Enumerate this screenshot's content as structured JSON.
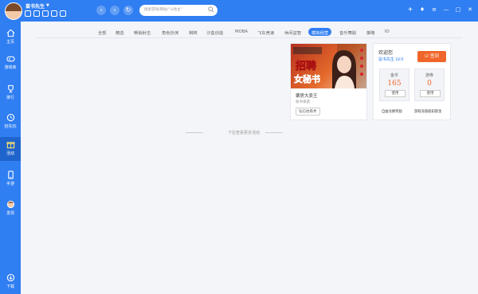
{
  "header": {
    "username": "鼠书先生",
    "search_placeholder": "搜索游戏/网站/\"斗地主\"",
    "window_controls": [
      "pin-icon",
      "skin-icon",
      "menu-icon",
      "minimize-icon",
      "maximize-icon",
      "close-icon"
    ]
  },
  "sidebar": {
    "items": [
      {
        "label": "主页",
        "icon": "home-icon"
      },
      {
        "label": "游戏库",
        "icon": "gamepad-icon"
      },
      {
        "label": "排行",
        "icon": "trophy-icon"
      },
      {
        "label": "抢先玩",
        "icon": "clock-icon"
      },
      {
        "label": "活动",
        "icon": "gift-icon"
      },
      {
        "label": "手游",
        "icon": "phone-icon"
      },
      {
        "label": "发现",
        "icon": "discover-icon"
      },
      {
        "label": "下载",
        "icon": "download-icon"
      }
    ],
    "active_index": 4
  },
  "categories": {
    "tabs": [
      "全部",
      "精选",
      "畅销射击",
      "角色扮演",
      "棋牌",
      "沙盒创造",
      "MOBA",
      "飞车竞速",
      "休闲益智",
      "模拟经营",
      "音乐舞蹈",
      "策略",
      "IO"
    ],
    "active_index": 9
  },
  "card": {
    "image_text": {
      "line1": "招聘",
      "line2": "女秘书"
    },
    "title": "票房大卖王",
    "subtitle": "秘书来袭",
    "badge": "钻石始看秀"
  },
  "panel": {
    "welcome": "欢迎您",
    "username": "鼠书先生 LV.0",
    "checkin_label": "签到",
    "gold": {
      "label": "金币",
      "value": "165",
      "button": "使用"
    },
    "voucher": {
      "label": "游券",
      "value": "0",
      "button": "使用"
    },
    "gold_note": "自由兑换奖励",
    "voucher_note": "游戏充值抵扣现金"
  },
  "more_hint": "下拉查看更多活动",
  "colors": {
    "primary": "#2f7ef2",
    "accent": "#f0662a",
    "background": "#f3f5f8"
  }
}
